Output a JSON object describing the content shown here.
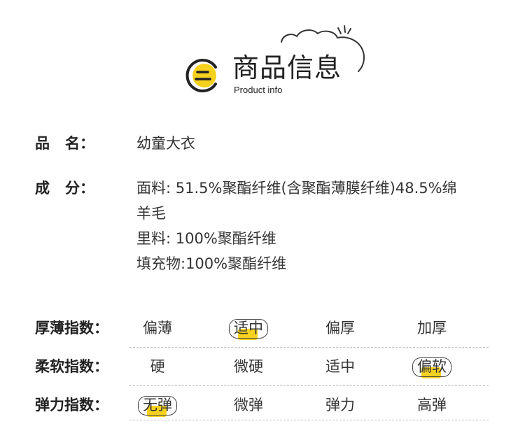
{
  "header": {
    "title": "商品信息",
    "subtitle": "Product info",
    "accent": "#f6d21f"
  },
  "info": [
    {
      "label_a": "品",
      "label_b": "名：",
      "lines": [
        "幼童大衣"
      ]
    },
    {
      "label_a": "成",
      "label_b": "分：",
      "lines": [
        "面料: 51.5%聚酯纤维(含聚酯薄膜纤维)48.5%绵",
        "羊毛",
        "里料: 100%聚酯纤维",
        "填充物:100%聚酯纤维"
      ]
    }
  ],
  "indices": [
    {
      "label": "厚薄指数：",
      "options": [
        "偏薄",
        "适中",
        "偏厚",
        "加厚"
      ],
      "selected": 1
    },
    {
      "label": "柔软指数：",
      "options": [
        "硬",
        "微硬",
        "适中",
        "偏软"
      ],
      "selected": 3
    },
    {
      "label": "弹力指数：",
      "options": [
        "无弹",
        "微弹",
        "弹力",
        "高弹"
      ],
      "selected": 0
    }
  ]
}
